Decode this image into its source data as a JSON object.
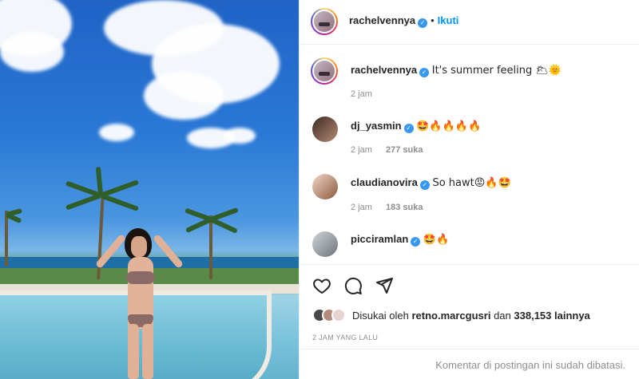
{
  "post": {
    "author": "rachelvennya",
    "follow_label": "Ikuti",
    "caption": "It's summer feeling 🌥🌞",
    "caption_time": "2 jam"
  },
  "comments": [
    {
      "user": "dj_yasmin",
      "text": "🤩🔥🔥🔥🔥",
      "time": "2 jam",
      "likes": "277 suka"
    },
    {
      "user": "claudianovira",
      "text": "So hawt😡🔥🤩",
      "time": "2 jam",
      "likes": "183 suka"
    },
    {
      "user": "picciramlan",
      "text": "🤩🔥"
    }
  ],
  "likes": {
    "prefix": "Disukai oleh",
    "user": "retno.marcgusri",
    "joiner": "dan",
    "count": "338,153 lainnya"
  },
  "posted_ago": "2 JAM YANG LALU",
  "comments_closed": "Komentar di postingan ini sudah dibatasi.",
  "icons": [
    "heart-icon",
    "comment-icon",
    "share-icon",
    "verified-badge-icon"
  ],
  "colors": {
    "link": "#0095f6",
    "verified": "#3897f0",
    "muted": "#8e8e8e"
  }
}
